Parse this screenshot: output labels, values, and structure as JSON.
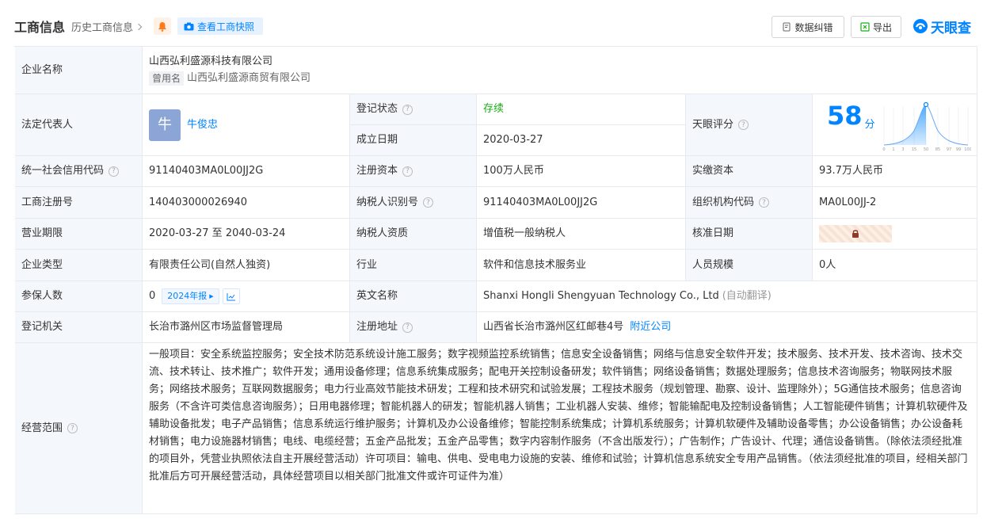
{
  "header": {
    "title": "工商信息",
    "history_link": "历史工商信息",
    "snapshot_button": "查看工商快照",
    "correct_button": "数据纠错",
    "export_button": "导出",
    "logo_text": "天眼查"
  },
  "company": {
    "name_label": "企业名称",
    "name": "山西弘利盛源科技有限公司",
    "former_tag": "曾用名",
    "former_name": "山西弘利盛源商贸有限公司",
    "legal_rep_label": "法定代表人",
    "legal_rep_avatar": "牛",
    "legal_rep": "牛俊忠",
    "reg_status_label": "登记状态",
    "reg_status": "存续",
    "found_date_label": "成立日期",
    "found_date": "2020-03-27",
    "score_label": "天眼评分",
    "score": "58",
    "score_unit": "分",
    "credit_code_label": "统一社会信用代码",
    "credit_code": "91140403MA0L00JJ2G",
    "reg_capital_label": "注册资本",
    "reg_capital": "100万人民币",
    "paid_capital_label": "实缴资本",
    "paid_capital": "93.7万人民币",
    "reg_no_label": "工商注册号",
    "reg_no": "140403000026940",
    "taxpayer_id_label": "纳税人识别号",
    "taxpayer_id": "91140403MA0L00JJ2G",
    "org_code_label": "组织机构代码",
    "org_code": "MA0L00JJ-2",
    "term_label": "营业期限",
    "term": "2020-03-27 至 2040-03-24",
    "taxpayer_qual_label": "纳税人资质",
    "taxpayer_qual": "增值税一般纳税人",
    "approve_date_label": "核准日期",
    "type_label": "企业类型",
    "type": "有限责任公司(自然人独资)",
    "industry_label": "行业",
    "industry": "软件和信息技术服务业",
    "staff_label": "人员规模",
    "staff": "0人",
    "insured_label": "参保人数",
    "insured": "0",
    "report_tag": "2024年报",
    "english_label": "英文名称",
    "english_name": "Shanxi Hongli Shengyuan Technology Co., Ltd",
    "auto_translate": "(自动翻译)",
    "authority_label": "登记机关",
    "authority": "长治市潞州区市场监督管理局",
    "address_label": "注册地址",
    "address": "山西省长治市潞州区红邮巷4号",
    "nearby_link": "附近公司",
    "scope_label": "经营范围",
    "scope": "一般项目：安全系统监控服务；安全技术防范系统设计施工服务；数字视频监控系统销售；信息安全设备销售；网络与信息安全软件开发；技术服务、技术开发、技术咨询、技术交流、技术转让、技术推广；软件开发；通用设备修理；信息系统集成服务；配电开关控制设备研发；软件销售；网络设备销售；数据处理服务；信息技术咨询服务；物联网技术服务；网络技术服务；互联网数据服务；电力行业高效节能技术研发；工程和技术研究和试验发展；工程技术服务（规划管理、勘察、设计、监理除外）；5G通信技术服务；信息咨询服务（不含许可类信息咨询服务）；日用电器修理；智能机器人的研发；智能机器人销售；工业机器人安装、维修；智能输配电及控制设备销售；人工智能硬件销售；计算机软硬件及辅助设备批发；电子产品销售；信息系统运行维护服务；计算机及办公设备维修；智能控制系统集成；计算机系统服务；计算机软硬件及辅助设备零售；办公设备销售；办公设备耗材销售；电力设施器材销售；电线、电缆经营；五金产品批发；五金产品零售；数字内容制作服务（不含出版发行）；广告制作；广告设计、代理；通信设备销售。（除依法须经批准的项目外，凭营业执照依法自主开展经营活动）许可项目：输电、供电、受电电力设施的安装、维修和试验；计算机信息系统安全专用产品销售。（依法须经批准的项目，经相关部门批准后方可开展经营活动，具体经营项目以相关部门批准文件或许可证件为准）"
  },
  "score_curve": {
    "ticks": [
      "0",
      "1",
      "3",
      "15",
      "50",
      "85",
      "97",
      "99",
      "100"
    ]
  },
  "colors": {
    "accent": "#0084ff",
    "label_bg": "#f4f7fb",
    "status_green": "#1aad19"
  }
}
